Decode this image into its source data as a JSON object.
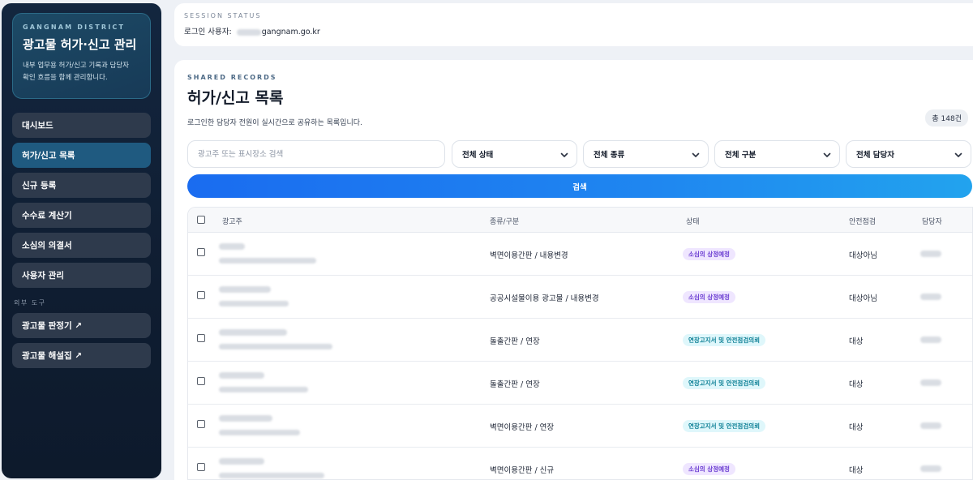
{
  "sidebar": {
    "eyebrow": "GANGNAM DISTRICT",
    "title": "광고물 허가·신고 관리",
    "desc_line1": "내부 업무용 허가/신고 기록과 담당자",
    "desc_line2": "확인 흐름을 함께 관리합니다.",
    "items": [
      {
        "label": "대시보드"
      },
      {
        "label": "허가/신고 목록"
      },
      {
        "label": "신규 등록"
      },
      {
        "label": "수수료 계산기"
      },
      {
        "label": "소심의 의결서"
      },
      {
        "label": "사용자 관리"
      }
    ],
    "external_label": "외부 도구",
    "external_items": [
      {
        "label": "광고물 판정기 ↗"
      },
      {
        "label": "광고물 해설집 ↗"
      }
    ]
  },
  "session": {
    "eyebrow": "SESSION STATUS",
    "user_prefix": "로그인 사용자:",
    "user_domain": "gangnam.go.kr"
  },
  "main": {
    "eyebrow": "SHARED RECORDS",
    "title": "허가/신고 목록",
    "desc": "로그인한 담당자 전원이 실시간으로 공유하는 목록입니다.",
    "count": "총 148건",
    "search_placeholder": "광고주 또는 표시장소 검색",
    "filters": [
      "전체 상태",
      "전체 종류",
      "전체 구분",
      "전체 담당자"
    ],
    "search_button": "검색"
  },
  "table": {
    "headers": {
      "advertiser": "광고주",
      "type": "종류/구분",
      "status": "상태",
      "safety": "안전점검",
      "manager": "담당자"
    },
    "rows": [
      {
        "type": "벽면이용간판 / 내용변경",
        "status": "소심의 상정예정",
        "status_color": "#6a3cd1",
        "safety": "대상아님"
      },
      {
        "type": "공공시설물이용 광고물 / 내용변경",
        "status": "소심의 상정예정",
        "status_color": "#6a3cd1",
        "safety": "대상아님"
      },
      {
        "type": "돌출간판 / 연장",
        "status": "연장고지서 및 안전점검의뢰",
        "status_color": "#0c7f95",
        "safety": "대상"
      },
      {
        "type": "돌출간판 / 연장",
        "status": "연장고지서 및 안전점검의뢰",
        "status_color": "#0c7f95",
        "safety": "대상"
      },
      {
        "type": "벽면이용간판 / 연장",
        "status": "연장고지서 및 안전점검의뢰",
        "status_color": "#0c7f95",
        "safety": "대상"
      },
      {
        "type": "벽면이용간판 / 신규",
        "status": "소심의 상정예정",
        "status_color": "#6a3cd1",
        "safety": "대상"
      }
    ]
  }
}
